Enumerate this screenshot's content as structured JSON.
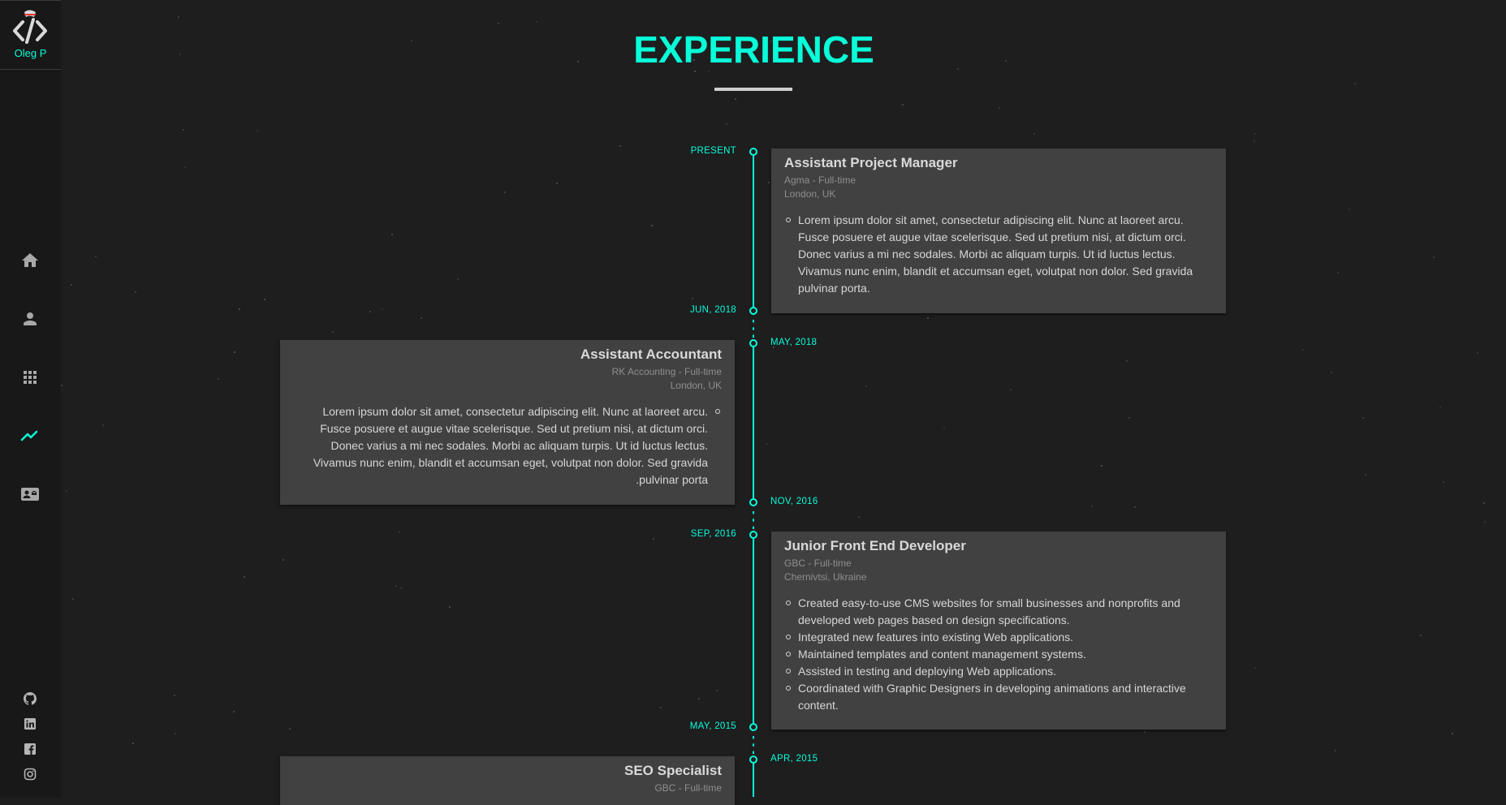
{
  "brand": {
    "name": "Oleg P",
    "logo": "code-brackets-logo-with-cap"
  },
  "nav": [
    {
      "icon": "home-icon",
      "label": "Home"
    },
    {
      "icon": "user-icon",
      "label": "About"
    },
    {
      "icon": "grid-icon",
      "label": "Portfolio"
    },
    {
      "icon": "trending-icon",
      "label": "Experience",
      "active": true
    },
    {
      "icon": "contact-card-icon",
      "label": "Contact"
    }
  ],
  "social": [
    {
      "icon": "github-icon"
    },
    {
      "icon": "linkedin-icon"
    },
    {
      "icon": "facebook-icon"
    },
    {
      "icon": "instagram-icon"
    }
  ],
  "colors": {
    "accent": "#08fdd8",
    "background": "#1e1e1f",
    "sidebar": "#181818",
    "card": "#414141"
  },
  "page": {
    "title": "EXPERIENCE"
  },
  "timeline": [
    {
      "start": "JUN, 2018",
      "end": "PRESENT",
      "title": "Assistant Project Manager",
      "company": "Agma - Full-time",
      "location": "London, UK",
      "bullets": [
        "Lorem ipsum dolor sit amet, consectetur adipiscing elit. Nunc at laoreet arcu. Fusce posuere et augue vitae scelerisque. Sed ut pretium nisi, at dictum orci. Donec varius a mi nec sodales. Morbi ac aliquam turpis. Ut id luctus lectus. Vivamus nunc enim, blandit et accumsan eget, volutpat non dolor. Sed gravida pulvinar porta."
      ]
    },
    {
      "start": "NOV, 2016",
      "end": "MAY, 2018",
      "title": "Assistant Accountant",
      "company": "RK Accounting - Full-time",
      "location": "London, UK",
      "bullets": [
        "Lorem ipsum dolor sit amet, consectetur adipiscing elit. Nunc at laoreet arcu. Fusce posuere et augue vitae scelerisque. Sed ut pretium nisi, at dictum orci. Donec varius a mi nec sodales. Morbi ac aliquam turpis. Ut id luctus lectus. Vivamus nunc enim, blandit et accumsan eget, volutpat non dolor. Sed gravida pulvinar porta."
      ]
    },
    {
      "start": "MAY, 2015",
      "end": "SEP, 2016",
      "title": "Junior Front End Developer",
      "company": "GBC - Full-time",
      "location": "Chernivtsi, Ukraine",
      "bullets": [
        "Created easy-to-use CMS websites for small businesses and nonprofits and developed web pages based on design specifications.",
        "Integrated new features into existing Web applications.",
        "Maintained templates and content management systems.",
        "Assisted in testing and deploying Web applications.",
        "Coordinated with Graphic Designers in developing animations and interactive content."
      ]
    },
    {
      "start": "",
      "end": "APR, 2015",
      "title": "SEO Specialist",
      "company": "GBC - Full-time",
      "location": "",
      "bullets": []
    }
  ]
}
